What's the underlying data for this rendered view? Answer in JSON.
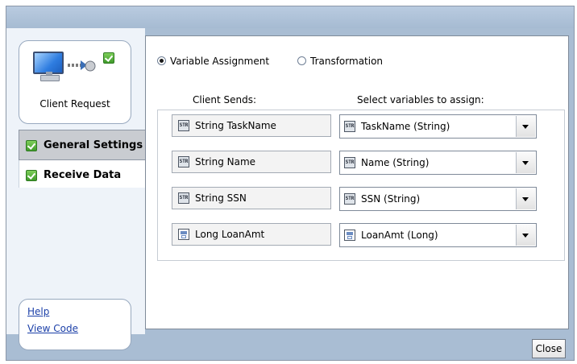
{
  "client": {
    "label": "Client Request"
  },
  "nav": {
    "items": [
      {
        "label": "General Settings",
        "checked": true,
        "active": true
      },
      {
        "label": "Receive Data",
        "checked": true,
        "active": false
      }
    ]
  },
  "help": {
    "help_link": "Help",
    "view_code_link": "View Code"
  },
  "mode": {
    "options": [
      {
        "label": "Variable Assignment",
        "selected": true
      },
      {
        "label": "Transformation",
        "selected": false
      }
    ]
  },
  "columns": {
    "client_sends": "Client Sends:",
    "select_vars": "Select variables to assign:"
  },
  "rows": [
    {
      "send_type_icon": "string-icon",
      "send": "String TaskName",
      "assign_icon": "string-icon",
      "assign": "TaskName (String)"
    },
    {
      "send_type_icon": "string-icon",
      "send": "String Name",
      "assign_icon": "string-icon",
      "assign": "Name (String)"
    },
    {
      "send_type_icon": "string-icon",
      "send": "String SSN",
      "assign_icon": "string-icon",
      "assign": "SSN (String)"
    },
    {
      "send_type_icon": "long-icon",
      "send": "Long LoanAmt",
      "assign_icon": "long-icon",
      "assign": "LoanAmt (Long)"
    }
  ],
  "footer": {
    "close_label": "Close"
  },
  "colors": {
    "frame": "#a9bdd3",
    "check_green": "#3f9a2a",
    "link": "#1b3fa8"
  }
}
